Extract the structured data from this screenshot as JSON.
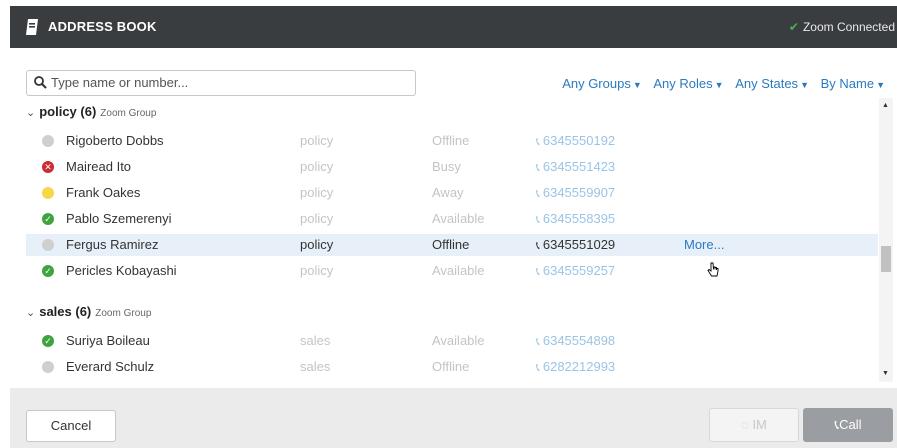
{
  "header": {
    "title": "ADDRESS BOOK",
    "status_text": "Zoom Connected",
    "status_check": "✔"
  },
  "search": {
    "placeholder": "Type name or number..."
  },
  "filters": {
    "groups": "Any Groups",
    "roles": "Any Roles",
    "states": "Any States",
    "sort": "By Name"
  },
  "groups": [
    {
      "name": "policy (6)",
      "subtitle": "Zoom Group",
      "contacts": [
        {
          "name": "Rigoberto Dobbs",
          "group": "policy",
          "state": "Offline",
          "phone": "6345550192",
          "status": "offline"
        },
        {
          "name": "Mairead Ito",
          "group": "policy",
          "state": "Busy",
          "phone": "6345551423",
          "status": "busy"
        },
        {
          "name": "Frank Oakes",
          "group": "policy",
          "state": "Away",
          "phone": "6345559907",
          "status": "away"
        },
        {
          "name": "Pablo Szemerenyi",
          "group": "policy",
          "state": "Available",
          "phone": "6345558395",
          "status": "available"
        },
        {
          "name": "Fergus Ramirez",
          "group": "policy",
          "state": "Offline",
          "phone": "6345551029",
          "status": "offline",
          "more": "More..."
        },
        {
          "name": "Pericles Kobayashi",
          "group": "policy",
          "state": "Available",
          "phone": "6345559257",
          "status": "available"
        }
      ]
    },
    {
      "name": "sales (6)",
      "subtitle": "Zoom Group",
      "contacts": [
        {
          "name": "Suriya Boileau",
          "group": "sales",
          "state": "Available",
          "phone": "6345554898",
          "status": "available"
        },
        {
          "name": "Everard Schulz",
          "group": "sales",
          "state": "Offline",
          "phone": "6282212993",
          "status": "offline"
        }
      ]
    }
  ],
  "footer": {
    "cancel": "Cancel",
    "im": "IM",
    "call": "Call"
  },
  "colors": {
    "header_bg": "#3a3d40",
    "link": "#2a7ac0",
    "available": "#3fa33f",
    "busy": "#cc2b35",
    "away": "#f7d64a",
    "offline": "#cfcfcf"
  }
}
